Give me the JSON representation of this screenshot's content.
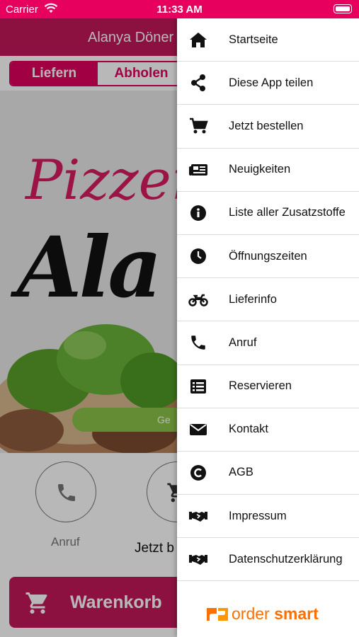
{
  "status_bar": {
    "carrier": "Carrier",
    "time": "11:33 AM"
  },
  "app": {
    "header_title": "Alanya Döner P",
    "tabs": [
      {
        "label": "Liefern"
      },
      {
        "label": "Abholen"
      }
    ],
    "hero": {
      "logo_line1": "Pizzer",
      "logo_line2": "Ala",
      "button_label": "Ge"
    },
    "quick_actions": [
      {
        "label": "Anruf",
        "icon": "phone-icon"
      },
      {
        "label": "Jetzt b",
        "icon": "cart-icon"
      }
    ],
    "cart_label": "Warenkorb"
  },
  "drawer": {
    "items": [
      {
        "label": "Startseite",
        "icon": "home-icon"
      },
      {
        "label": "Diese App teilen",
        "icon": "share-icon"
      },
      {
        "label": "Jetzt bestellen",
        "icon": "cart-icon"
      },
      {
        "label": "Neuigkeiten",
        "icon": "newspaper-icon"
      },
      {
        "label": "Liste aller Zusatzstoffe",
        "icon": "info-icon"
      },
      {
        "label": "Öffnungszeiten",
        "icon": "clock-icon"
      },
      {
        "label": "Lieferinfo",
        "icon": "motorcycle-icon"
      },
      {
        "label": "Anruf",
        "icon": "phone-icon"
      },
      {
        "label": "Reservieren",
        "icon": "list-icon"
      },
      {
        "label": "Kontakt",
        "icon": "envelope-icon"
      },
      {
        "label": "AGB",
        "icon": "copyright-icon"
      },
      {
        "label": "Impressum",
        "icon": "handshake-icon"
      },
      {
        "label": "Datenschutzerklärung",
        "icon": "handshake-icon"
      }
    ],
    "footer_brand": {
      "word1": "order",
      "word2": "smart"
    }
  },
  "colors": {
    "brand": "#e8005f",
    "brand_dark": "#c2185b",
    "accent_green": "#8bc34a",
    "logo_orange": "#ff6f00"
  }
}
